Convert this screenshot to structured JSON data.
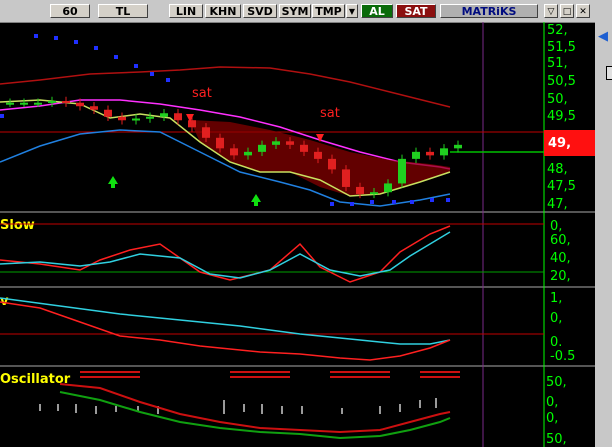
{
  "toolbar": {
    "items": [
      "60",
      "TL",
      "LIN",
      "KHN",
      "SVD",
      "SYM",
      "TMP"
    ],
    "dropdown_icon": "dropdown-arrow-icon",
    "buy_label": "AL",
    "sell_label": "SAT",
    "brand": "MATRiKS",
    "window_buttons": [
      "restore-icon",
      "settings-icon",
      "close-icon"
    ]
  },
  "colors": {
    "buy": "#0a6b0a",
    "sell": "#8b0f0f",
    "axis": "#00ff00",
    "red_line": "#ff0000",
    "cyan_line": "#40e0f0"
  },
  "price_panel": {
    "axis_labels": [
      "52,",
      "51,5",
      "51,",
      "50,5",
      "50,",
      "49,5",
      "48,",
      "47,5",
      "47,"
    ],
    "current_price": "49,",
    "sell_signals": [
      "sat",
      "sat"
    ],
    "chart_data": {
      "type": "candlestick",
      "ylim": [
        46.9,
        52.2
      ],
      "closes": [
        49.9,
        49.9,
        49.9,
        49.95,
        49.9,
        49.8,
        49.7,
        49.5,
        49.4,
        49.45,
        49.5,
        49.6,
        49.4,
        49.2,
        48.9,
        48.6,
        48.4,
        48.5,
        48.7,
        48.8,
        48.7,
        48.5,
        48.3,
        48.0,
        47.5,
        47.3,
        47.35,
        47.6,
        48.3,
        48.5,
        48.4,
        48.6,
        48.7
      ]
    }
  },
  "slow_panel": {
    "title": "Slow",
    "axis_labels": [
      "0,",
      "60,",
      "40,",
      "20,"
    ]
  },
  "macd_panel": {
    "title": "v",
    "axis_labels": [
      "1,",
      "0,",
      "0.",
      "-0.5"
    ]
  },
  "osc_panel": {
    "title": "Oscillator",
    "axis_labels": [
      "50,",
      "0,",
      "0,",
      "50,"
    ]
  }
}
